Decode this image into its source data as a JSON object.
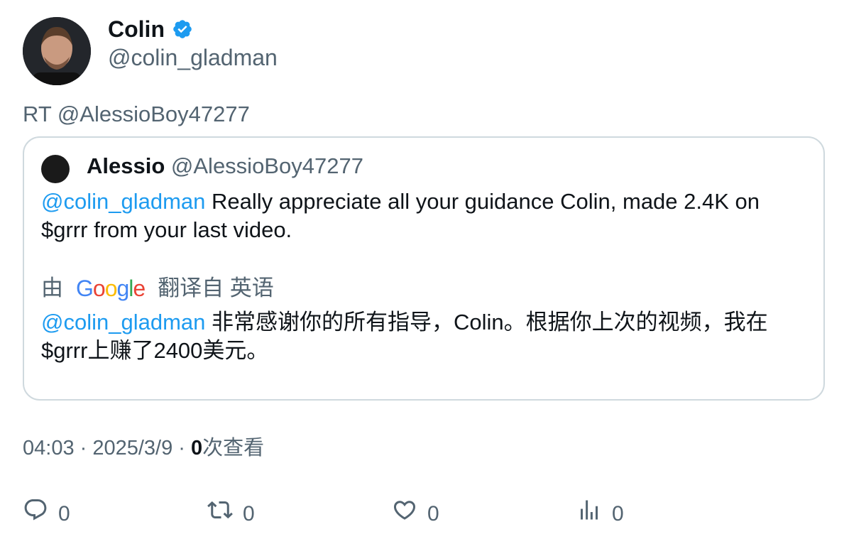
{
  "author": {
    "name": "Colin",
    "handle": "@colin_gladman",
    "verified_icon": "verified-badge-icon",
    "verified_color": "#1d9bf0"
  },
  "retweet_line": "RT @AlessioBoy47277",
  "quote": {
    "name": "Alessio",
    "handle": "@AlessioBoy47277",
    "mention": "@colin_gladman",
    "text": " Really appreciate all your guidance Colin, made 2.4K on $grrr from your last video.",
    "translate_prefix": "由",
    "translate_brand": "Google",
    "translate_suffix": "翻译自 英语",
    "translated_mention": "@colin_gladman",
    "translated_text": " 非常感谢你的所有指导，Colin。根据你上次的视频，我在$grrr上赚了2400美元。"
  },
  "meta": {
    "time_date": "04:03 · 2025/3/9 · ",
    "views_count": "0",
    "views_label": "次查看"
  },
  "actions": {
    "reply_count": "0",
    "retweet_count": "0",
    "like_count": "0",
    "views_count": "0"
  },
  "colors": {
    "accent": "#1d9bf0",
    "secondary_text": "#536471",
    "primary_text": "#0f1419",
    "border": "#cfd9de"
  }
}
